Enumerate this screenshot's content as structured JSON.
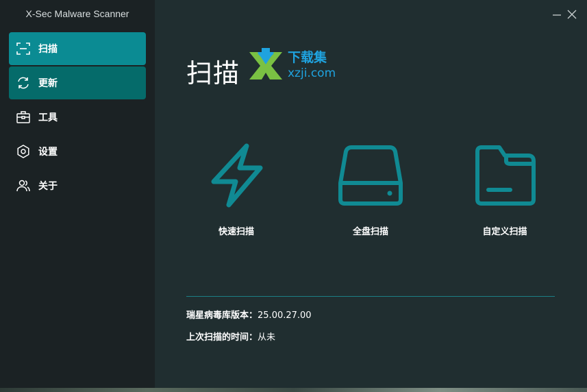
{
  "app": {
    "title": "X-Sec Malware Scanner"
  },
  "sidebar": {
    "items": [
      {
        "label": "扫描",
        "icon": "scan-frame-icon",
        "state": "active"
      },
      {
        "label": "更新",
        "icon": "refresh-icon",
        "state": "hover"
      },
      {
        "label": "工具",
        "icon": "toolbox-icon",
        "state": "normal"
      },
      {
        "label": "设置",
        "icon": "settings-gear-icon",
        "state": "normal"
      },
      {
        "label": "关于",
        "icon": "users-icon",
        "state": "normal"
      }
    ]
  },
  "main": {
    "title": "扫描",
    "watermark": {
      "brand": "下载集",
      "domain": "xzji.com"
    },
    "scan_options": [
      {
        "label": "快速扫描",
        "icon": "lightning-icon"
      },
      {
        "label": "全盘扫描",
        "icon": "hard-drive-icon"
      },
      {
        "label": "自定义扫描",
        "icon": "folder-icon"
      }
    ],
    "info": {
      "db_version_label": "瑞星病毒库版本：",
      "db_version_value": "25.00.27.00",
      "last_scan_label": "上次扫描的时间：",
      "last_scan_value": "从未"
    }
  },
  "colors": {
    "accent": "#0b8b93",
    "accent_hover": "#056b6a",
    "icon_teal": "#108a93",
    "sidebar_bg": "#1b2224",
    "main_bg": "#202e30"
  }
}
